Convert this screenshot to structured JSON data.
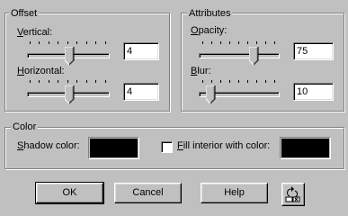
{
  "offset": {
    "title": "Offset",
    "vertical": {
      "label_prefix": "",
      "label_access": "V",
      "label_rest": "ertical:",
      "value": "4"
    },
    "horizontal": {
      "label_prefix": "",
      "label_access": "H",
      "label_rest": "orizontal:",
      "value": "4"
    }
  },
  "attributes": {
    "title": "Attributes",
    "opacity": {
      "label_prefix": "",
      "label_access": "O",
      "label_rest": "pacity:",
      "value": "75"
    },
    "blur": {
      "label_prefix": "",
      "label_access": "B",
      "label_rest": "lur:",
      "value": "10"
    }
  },
  "color": {
    "title": "Color",
    "shadow_label_access": "S",
    "shadow_label_rest": "hadow color:",
    "fill_label_access": "F",
    "fill_label_rest": "ill interior with color:",
    "fill_checked": false,
    "shadow_swatch_color": "#000000",
    "fill_swatch_color": "#000000"
  },
  "buttons": {
    "ok": "OK",
    "cancel": "Cancel",
    "help": "Help"
  },
  "icons": {
    "reset": "reset-shadow-icon"
  }
}
